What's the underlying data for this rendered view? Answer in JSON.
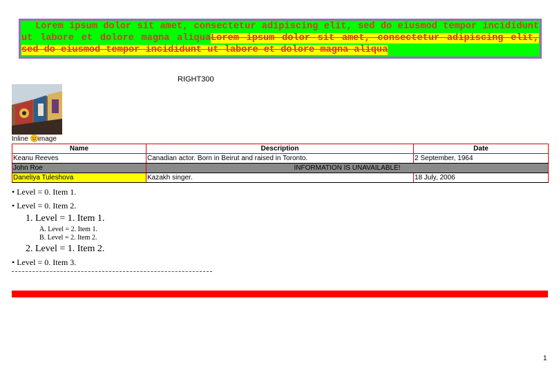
{
  "banner": {
    "plain": "Lorem ipsum dolor sit amet, consectetur adipiscing elit, sed do eiusmod tempor incididunt ut labore et dolore magna aliqua",
    "struck": "Lorem ipsum dolor sit amet, consectetur adipiscing elit, sed do eiusmod tempor incididunt ut labore et dolore magna aliqua"
  },
  "right_label": "RIGHT300",
  "caption": {
    "before": "Inline",
    "after": "image"
  },
  "table": {
    "headers": [
      "Name",
      "Description",
      "Date"
    ],
    "rows": [
      {
        "name": "Keanu Reeves",
        "description": "Canadian actor. Born in Beirut and raised in Toronto.",
        "date": "2 September, 1964"
      },
      {
        "name": "John Roe",
        "merged": "INFORMATION IS UNAVAILABLE!"
      },
      {
        "name": "Daneliya Tuleshova",
        "description": "Kazakh singer.",
        "date": "18 July, 2006"
      }
    ]
  },
  "list": {
    "item1": "Level = 0. Item 1.",
    "item2": "Level = 0. Item 2.",
    "sub1": "Level = 1. Item 1.",
    "subsub1": "Level = 2. Item 1.",
    "subsub2": "Level = 2. Item 2.",
    "sub2": "Level = 1. Item 2.",
    "item3": "Level = 0. Item 3.",
    "bullet": "•",
    "num1": "1.",
    "num2": "2.",
    "letA": "A.",
    "letB": "B."
  },
  "colors": {
    "banner_bg": "#00ff00",
    "banner_text": "#dc3333",
    "highlight": "#ffff00",
    "bar": "#ff0000",
    "border": "#9b6bc0"
  },
  "page_number": "1"
}
